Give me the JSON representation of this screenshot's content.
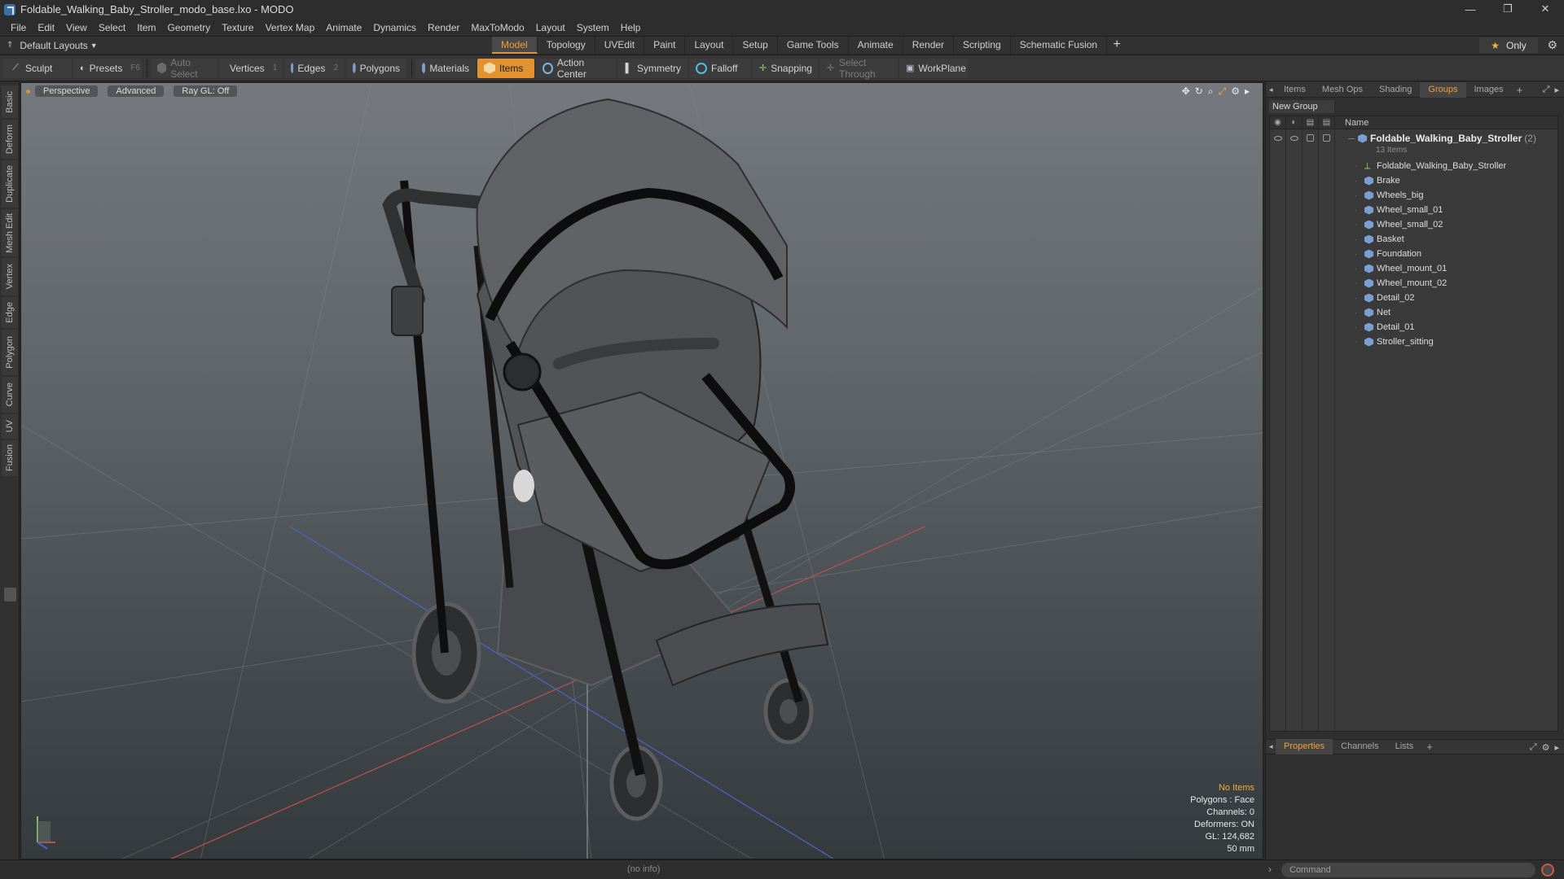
{
  "window": {
    "title": "Foldable_Walking_Baby_Stroller_modo_base.lxo - MODO",
    "controls": [
      "—",
      "❐",
      "✕"
    ]
  },
  "menu": [
    "File",
    "Edit",
    "View",
    "Select",
    "Item",
    "Geometry",
    "Texture",
    "Vertex Map",
    "Animate",
    "Dynamics",
    "Render",
    "MaxToModo",
    "Layout",
    "System",
    "Help"
  ],
  "layout_selector": "Default Layouts",
  "tabs": [
    "Model",
    "Topology",
    "UVEdit",
    "Paint",
    "Layout",
    "Setup",
    "Game Tools",
    "Animate",
    "Render",
    "Scripting",
    "Schematic Fusion"
  ],
  "active_tab": "Model",
  "only_label": "Only",
  "toolbar": {
    "sculpt": "Sculpt",
    "presets": "Presets",
    "presets_key": "F6",
    "auto_select": "Auto Select",
    "vertices": "Vertices",
    "vertices_count": "1",
    "edges": "Edges",
    "edges_count": "2",
    "polygons": "Polygons",
    "materials": "Materials",
    "items": "Items",
    "action_center": "Action Center",
    "symmetry": "Symmetry",
    "falloff": "Falloff",
    "snapping": "Snapping",
    "select_through": "Select Through",
    "workplane": "WorkPlane"
  },
  "left_tabs": [
    "Basic",
    "Deform",
    "Duplicate",
    "Mesh Edit",
    "Vertex",
    "Edge",
    "Polygon",
    "Curve",
    "UV",
    "Fusion"
  ],
  "viewport": {
    "view_mode": "Perspective",
    "shading": "Advanced",
    "raygl": "Ray GL: Off",
    "hud": {
      "selection": "No Items",
      "polygons": "Polygons : Face",
      "channels": "Channels: 0",
      "deformers": "Deformers: ON",
      "gl": "GL: 124,682",
      "scale": "50 mm"
    }
  },
  "status": {
    "info": "(no info)",
    "command_placeholder": "Command"
  },
  "right_panel": {
    "tabs": [
      "Items",
      "Mesh Ops",
      "Shading",
      "Groups",
      "Images"
    ],
    "active_tab": "Groups",
    "new_group": "New Group",
    "name_header": "Name",
    "group": {
      "name": "Foldable_Walking_Baby_Stroller",
      "count": "(2)",
      "items_label": "13 Items",
      "children": [
        {
          "name": "Foldable_Walking_Baby_Stroller",
          "type": "locator"
        },
        {
          "name": "Brake",
          "type": "mesh"
        },
        {
          "name": "Wheels_big",
          "type": "mesh"
        },
        {
          "name": "Wheel_small_01",
          "type": "mesh"
        },
        {
          "name": "Wheel_small_02",
          "type": "mesh"
        },
        {
          "name": "Basket",
          "type": "mesh"
        },
        {
          "name": "Foundation",
          "type": "mesh"
        },
        {
          "name": "Wheel_mount_01",
          "type": "mesh"
        },
        {
          "name": "Wheel_mount_02",
          "type": "mesh"
        },
        {
          "name": "Detail_02",
          "type": "mesh"
        },
        {
          "name": "Net",
          "type": "mesh"
        },
        {
          "name": "Detail_01",
          "type": "mesh"
        },
        {
          "name": "Stroller_sitting",
          "type": "mesh"
        }
      ]
    },
    "props_tabs": [
      "Properties",
      "Channels",
      "Lists"
    ],
    "props_active": "Properties"
  },
  "colors": {
    "accent": "#e2922f",
    "active_text": "#f0a030",
    "background": "#2b2b2b"
  }
}
